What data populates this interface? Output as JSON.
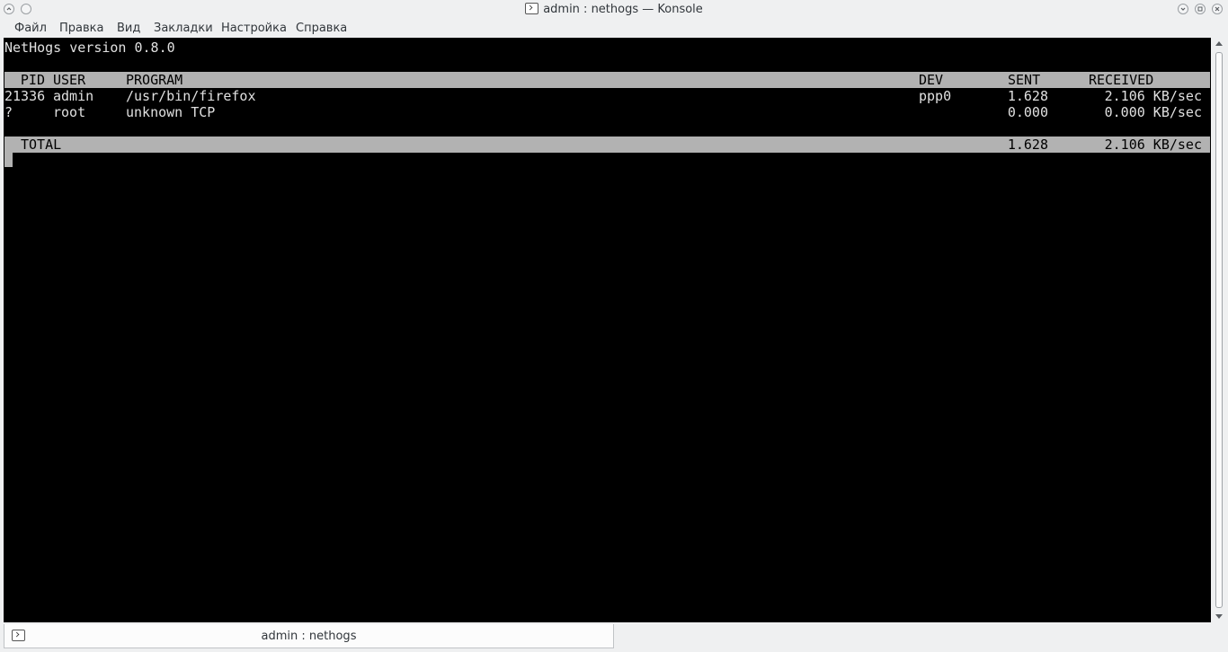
{
  "window": {
    "title": "admin : nethogs — Konsole"
  },
  "menubar": {
    "items": [
      "Файл",
      "Правка",
      "Вид",
      "Закладки",
      "Настройка",
      "Справка"
    ]
  },
  "terminal": {
    "version_line": "NetHogs version 0.8.0",
    "headers": {
      "pid": "PID",
      "user": "USER",
      "program": "PROGRAM",
      "dev": "DEV",
      "sent": "SENT",
      "received": "RECEIVED"
    },
    "rows": [
      {
        "pid": "21336",
        "user": "admin",
        "program": "/usr/bin/firefox",
        "dev": "ppp0",
        "sent": "1.628",
        "received": "2.106 KB/sec"
      },
      {
        "pid": "?",
        "user": "root",
        "program": "unknown TCP",
        "dev": "",
        "sent": "0.000",
        "received": "0.000 KB/sec"
      }
    ],
    "total": {
      "label": "TOTAL",
      "sent": "1.628",
      "received": "2.106 KB/sec"
    }
  },
  "tabs": [
    {
      "label": "admin : nethogs",
      "icon": "terminal-icon"
    }
  ],
  "colors": {
    "terminal_bg": "#000000",
    "terminal_fg": "#e0e0e0",
    "header_bg": "#b2b2b2"
  }
}
